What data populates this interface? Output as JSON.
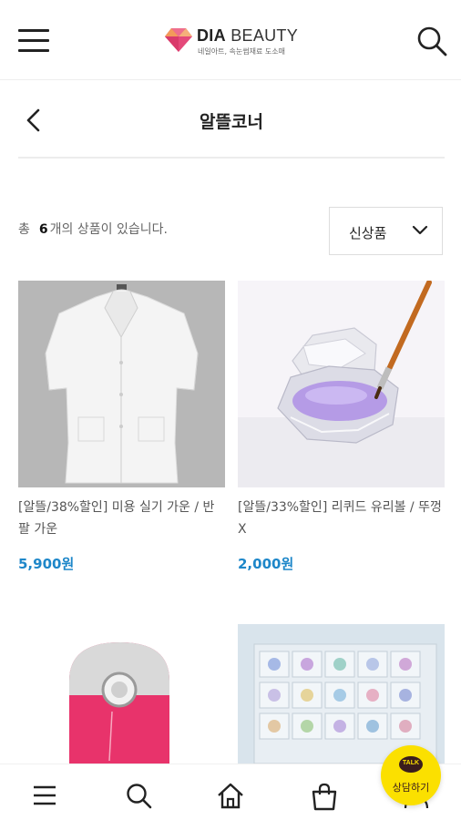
{
  "header": {
    "brand_bold": "DIA",
    "brand_light": "BEAUTY",
    "tagline": "네일아트, 속눈썹재료 도소매"
  },
  "page": {
    "title": "알뜰코너"
  },
  "listing": {
    "count_prefix": "총",
    "count": "6",
    "count_suffix": "개의 상품이 있습니다.",
    "sort_selected": "신상품"
  },
  "products": [
    {
      "name": "[알뜰/38%할인] 미용 실기 가운 / 반팔 가운",
      "price": "5,900원"
    },
    {
      "name": "[알뜰/33%할인] 리퀴드 유리볼 / 뚜껑 X",
      "price": "2,000원"
    },
    {
      "name": "",
      "price": ""
    },
    {
      "name": "",
      "price": ""
    }
  ],
  "kakao": {
    "bubble": "TALK",
    "label": "상담하기"
  },
  "icons": {
    "menu": "menu-icon",
    "search": "search-icon",
    "back": "chevron-left-icon",
    "sort": "chevron-down-icon",
    "home": "home-icon",
    "bag": "shopping-bag-icon",
    "user": "user-icon"
  },
  "colors": {
    "price": "#1e87c9",
    "logo_pink": "#e4497a",
    "logo_orange": "#f29a5a",
    "kakao_yellow": "#fbe000",
    "product_pink": "#e8336b"
  }
}
